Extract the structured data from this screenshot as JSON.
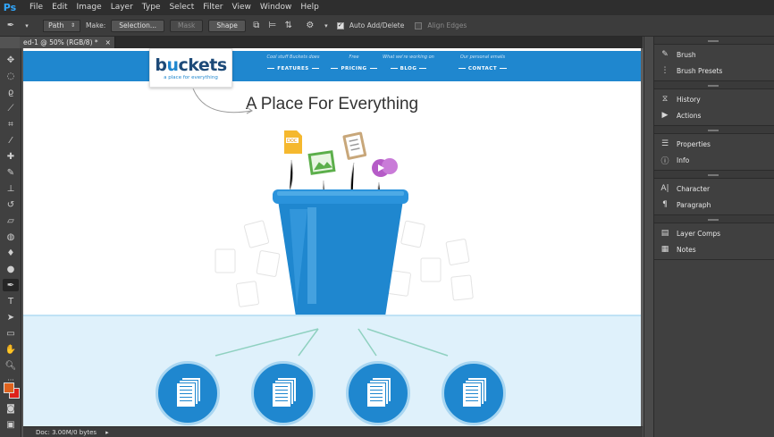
{
  "app": {
    "logo": "Ps"
  },
  "menu": [
    "File",
    "Edit",
    "Image",
    "Layer",
    "Type",
    "Select",
    "Filter",
    "View",
    "Window",
    "Help"
  ],
  "options": {
    "mode_value": "Path",
    "make_label": "Make:",
    "selection_label": "Selection...",
    "mask_label": "Mask",
    "shape_label": "Shape",
    "auto_add_delete_label": "Auto Add/Delete",
    "align_edges_label": "Align Edges"
  },
  "document_tab": {
    "title": "ed-1 @ 50% (RGB/8) *",
    "close": "×"
  },
  "status": {
    "zoom": "50%",
    "doc": "Doc: 3.00M/0 bytes",
    "arrow": "▸"
  },
  "colors": {
    "foreground": "#e0621d",
    "background": "#e0211a",
    "accent": "#1f87cf"
  },
  "website": {
    "logo_text_b": "b",
    "logo_text_u": "u",
    "logo_text_rest": "ckets",
    "logo_tagline": "a place for everything",
    "nav": [
      {
        "tiny": "Cool stuff Buckets does",
        "label": "FEATURES"
      },
      {
        "tiny": "Free",
        "label": "PRICING"
      },
      {
        "tiny": "What we're working on",
        "label": "BLOG"
      },
      {
        "tiny": "Our personal emails",
        "label": "CONTACT"
      }
    ],
    "headline": "A Place For Everything",
    "doc_badge": "DOC"
  },
  "panels": [
    {
      "items": [
        {
          "icon": "brush-icon",
          "label": "Brush"
        },
        {
          "icon": "brush-presets-icon",
          "label": "Brush Presets"
        }
      ]
    },
    {
      "items": [
        {
          "icon": "history-icon",
          "label": "History"
        },
        {
          "icon": "actions-icon",
          "label": "Actions"
        }
      ]
    },
    {
      "items": [
        {
          "icon": "properties-icon",
          "label": "Properties"
        },
        {
          "icon": "info-icon",
          "label": "Info"
        }
      ]
    },
    {
      "items": [
        {
          "icon": "character-icon",
          "label": "Character"
        },
        {
          "icon": "paragraph-icon",
          "label": "Paragraph"
        }
      ]
    },
    {
      "items": [
        {
          "icon": "layer-comps-icon",
          "label": "Layer Comps"
        },
        {
          "icon": "notes-icon",
          "label": "Notes"
        }
      ]
    }
  ]
}
